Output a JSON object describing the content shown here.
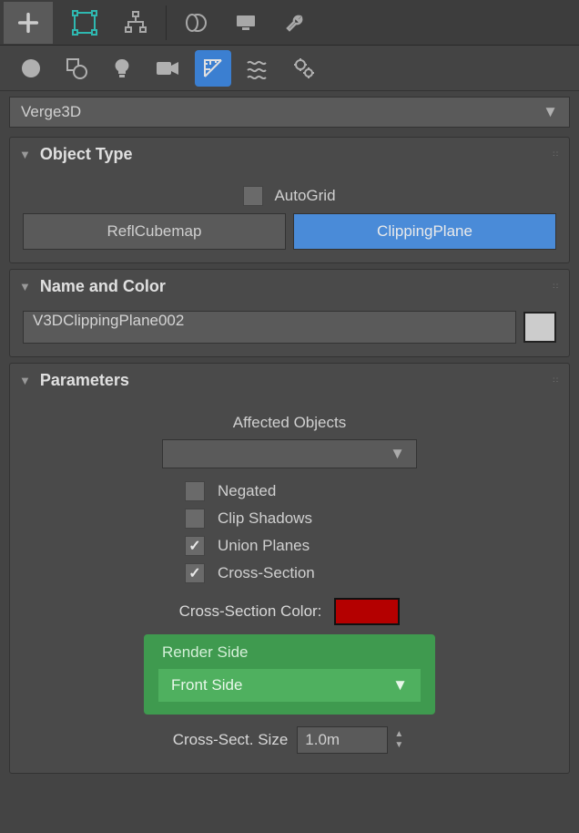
{
  "topDropdown": {
    "label": "Verge3D"
  },
  "panels": {
    "objectType": {
      "title": "Object Type",
      "autoGrid": {
        "label": "AutoGrid",
        "checked": false
      },
      "buttons": [
        "ReflCubemap",
        "ClippingPlane"
      ],
      "activeIndex": 1
    },
    "nameColor": {
      "title": "Name and Color",
      "name": "V3DClippingPlane002",
      "color": "#cccccc"
    },
    "parameters": {
      "title": "Parameters",
      "affectedObjectsLabel": "Affected Objects",
      "checks": [
        {
          "label": "Negated",
          "checked": false
        },
        {
          "label": "Clip Shadows",
          "checked": false
        },
        {
          "label": "Union Planes",
          "checked": true
        },
        {
          "label": "Cross-Section",
          "checked": true
        }
      ],
      "crossSectionColor": {
        "label": "Cross-Section Color:",
        "value": "#b40000"
      },
      "renderSide": {
        "label": "Render Side",
        "value": "Front Side"
      },
      "crossSectSize": {
        "label": "Cross-Sect. Size",
        "value": "1.0m"
      }
    }
  }
}
